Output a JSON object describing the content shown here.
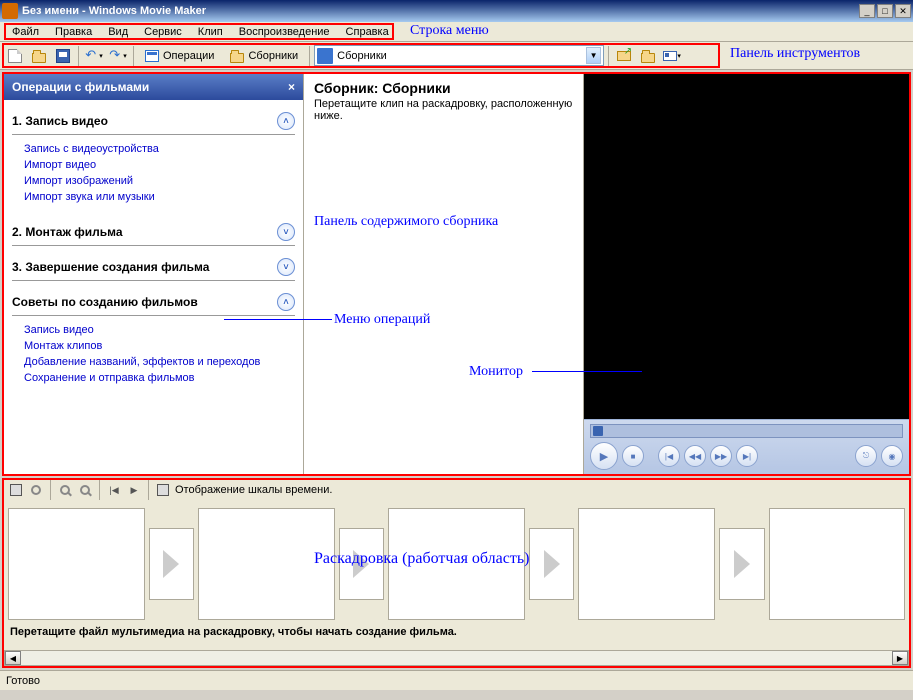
{
  "window": {
    "title": "Без имени - Windows Movie Maker"
  },
  "menu": {
    "items": [
      "Файл",
      "Правка",
      "Вид",
      "Сервис",
      "Клип",
      "Воспроизведение",
      "Справка"
    ]
  },
  "toolbar": {
    "operations_label": "Операции",
    "collections_label": "Сборники",
    "dropdown_value": "Сборники"
  },
  "annotations": {
    "menubar": "Строка меню",
    "toolbar": "Панель инструментов",
    "content": "Панель содержимого сборника",
    "operations": "Меню операций",
    "monitor": "Монитор",
    "storyboard": "Раскадровка (работчая область)"
  },
  "taskpane": {
    "title": "Операции с фильмами",
    "sections": [
      {
        "title": "1. Запись видео",
        "expanded": true,
        "links": [
          "Запись с видеоустройства",
          "Импорт видео",
          "Импорт изображений",
          "Импорт звука или музыки"
        ]
      },
      {
        "title": "2. Монтаж фильма",
        "expanded": false
      },
      {
        "title": "3. Завершение создания фильма",
        "expanded": false
      },
      {
        "title": "Советы по созданию фильмов",
        "expanded": true,
        "links": [
          "Запись видео",
          "Монтаж клипов",
          "Добавление названий, эффектов и переходов",
          "Сохранение и отправка фильмов"
        ]
      }
    ]
  },
  "content": {
    "title": "Сборник: Сборники",
    "hint": "Перетащите клип на раскадровку, расположенную ниже."
  },
  "timeline": {
    "view_label": "Отображение шкалы времени.",
    "hint": "Перетащите файл мультимедиа на раскадровку, чтобы начать создание фильма."
  },
  "status": {
    "text": "Готово"
  }
}
